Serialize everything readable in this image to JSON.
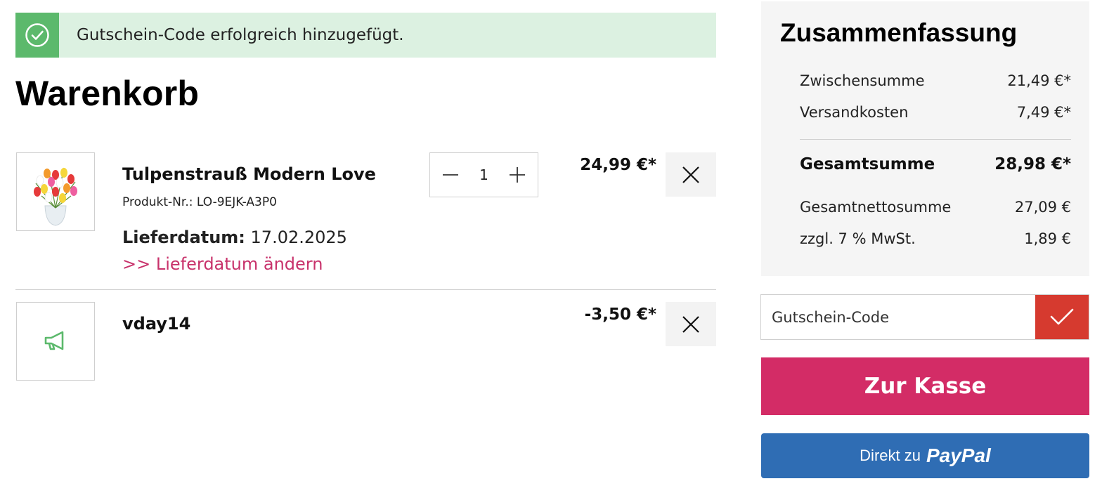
{
  "alert": {
    "message": "Gutschein-Code erfolgreich hinzugefügt.",
    "icon": "check-circle-icon",
    "color_background": "#dcf1e1",
    "color_icon_box": "#5cb96c"
  },
  "page_title": "Warenkorb",
  "cart": {
    "items": [
      {
        "name": "Tulpenstrauß Modern Love",
        "sku": "Produkt-Nr.: LO-9EJK-A3P0",
        "delivery_label": "Lieferdatum:",
        "delivery_date": "17.02.2025",
        "change_link": ">> Lieferdatum ändern",
        "quantity": "1",
        "price": "24,99 €*",
        "image": "tulip-bouquet-image"
      },
      {
        "name": "vday14",
        "price": "-3,50 €*",
        "image": "megaphone-icon"
      }
    ]
  },
  "summary": {
    "title": "Zusammenfassung",
    "subtotal_label": "Zwischensumme",
    "subtotal_value": "21,49 €*",
    "shipping_label": "Versandkosten",
    "shipping_value": "7,49 €*",
    "total_label": "Gesamtsumme",
    "total_value": "28,98 €*",
    "net_label": "Gesamtnettosumme",
    "net_value": "27,09 €",
    "vat_label": "zzgl. 7 % MwSt.",
    "vat_value": "1,89 €"
  },
  "voucher": {
    "placeholder": "Gutschein-Code",
    "submit_icon": "checkmark-icon"
  },
  "checkout_label": "Zur Kasse",
  "paypal": {
    "prefix": "Direkt zu",
    "brand": "PayPal"
  },
  "colors": {
    "accent_pink": "#d32c66",
    "link_pink": "#c8326b",
    "voucher_red": "#d63a2f",
    "paypal_blue": "#2f6db4",
    "success_green": "#5cb96c"
  }
}
